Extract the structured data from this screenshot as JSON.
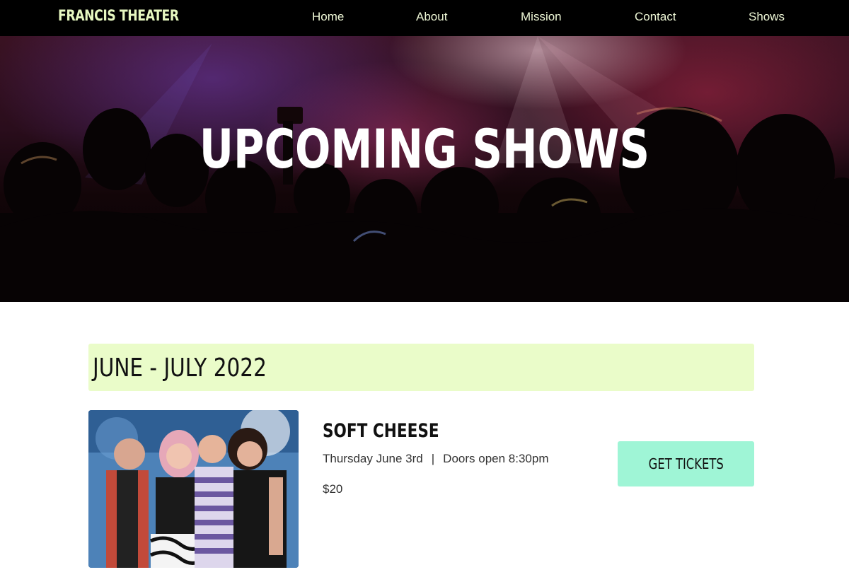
{
  "nav": {
    "brand": "FRANCIS THEATER",
    "links": [
      {
        "label": "Home"
      },
      {
        "label": "About"
      },
      {
        "label": "Mission"
      },
      {
        "label": "Contact"
      },
      {
        "label": "Shows"
      }
    ]
  },
  "hero": {
    "title": "UPCOMING SHOWS"
  },
  "schedule": {
    "month_heading": "JUNE - JULY 2022",
    "shows": [
      {
        "name": "SOFT CHEESE",
        "date": "Thursday June 3rd",
        "separator": "|",
        "doors": "Doors open 8:30pm",
        "price": "$20",
        "ticket_label": "GET TICKETS"
      }
    ]
  },
  "colors": {
    "nav_bg": "#000000",
    "brand": "#e6f7c0",
    "month_banner_bg": "#eafcc9",
    "ticket_button_bg": "#9ff5d6"
  }
}
